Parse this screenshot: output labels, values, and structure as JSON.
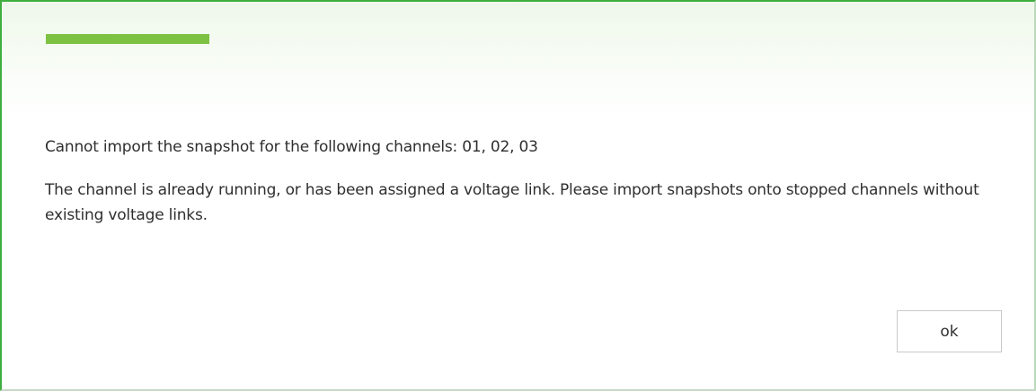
{
  "dialog": {
    "accent_color": "#7dc242",
    "border_color": "#3fae3f",
    "message_line_1": "Cannot import the snapshot for the following channels: 01, 02, 03",
    "message_line_2": "The channel is already running, or has been assigned a voltage link. Please import snapshots onto stopped channels without existing voltage links.",
    "ok_label": "ok"
  }
}
